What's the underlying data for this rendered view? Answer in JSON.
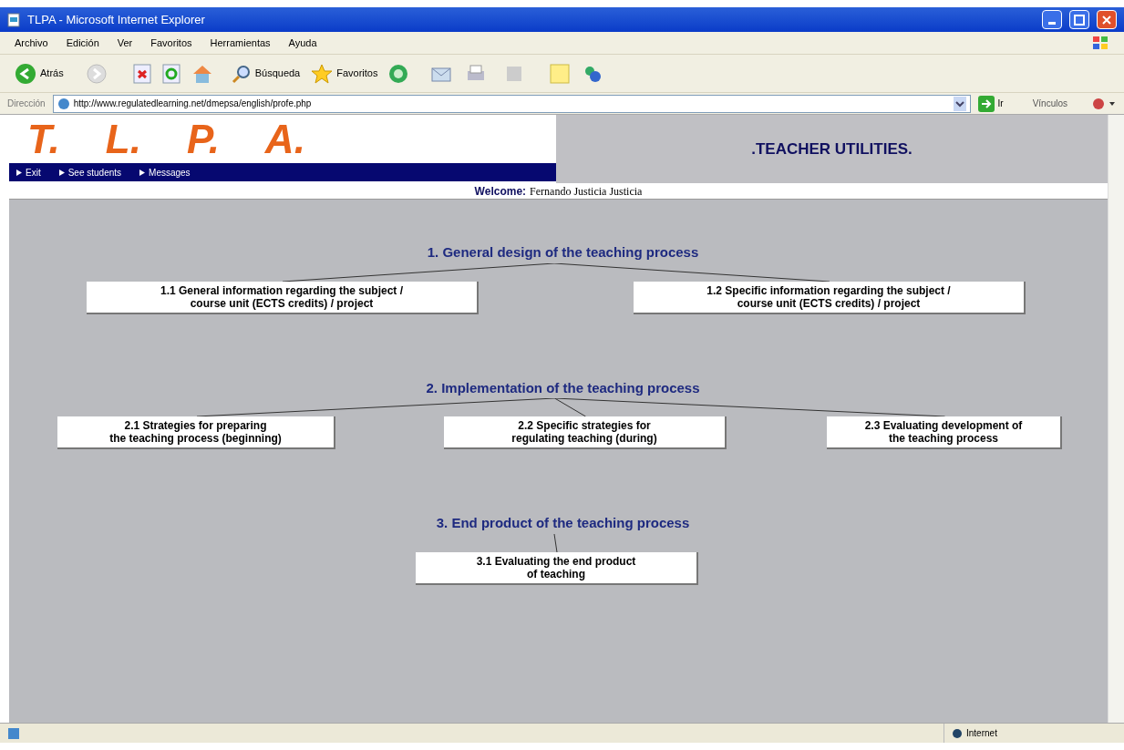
{
  "window": {
    "title": "TLPA - Microsoft Internet Explorer"
  },
  "menu": [
    "Archivo",
    "Edición",
    "Ver",
    "Favoritos",
    "Herramientas",
    "Ayuda"
  ],
  "toolbar": {
    "back": "Atrás",
    "search": "Búsqueda",
    "favorites": "Favoritos"
  },
  "address": {
    "label": "Dirección",
    "url": "http://www.regulatedlearning.net/dmepsa/english/profe.php",
    "go": "Ir",
    "links": "Vínculos"
  },
  "header": {
    "logo": [
      "T.",
      "L.",
      "P.",
      "A."
    ],
    "nav": [
      "Exit",
      "See students",
      "Messages"
    ],
    "title": ".TEACHER UTILITIES."
  },
  "welcome": {
    "label": "Welcome:",
    "name": "Fernando Justicia Justicia"
  },
  "sections": [
    {
      "heading": "1. General design of the teaching process",
      "items": [
        "1.1 General information regarding the subject /\ncourse unit (ECTS credits) / project",
        "1.2 Specific information regarding the subject /\ncourse unit (ECTS credits) / project"
      ]
    },
    {
      "heading": "2. Implementation of the teaching process",
      "items": [
        "2.1 Strategies for preparing\nthe teaching process (beginning)",
        "2.2 Specific strategies for\nregulating teaching (during)",
        "2.3 Evaluating development of\nthe teaching process"
      ]
    },
    {
      "heading": "3. End product of the teaching process",
      "items": [
        "3.1 Evaluating the end product\nof teaching"
      ]
    }
  ],
  "status_bar": {
    "zone": "Internet"
  }
}
